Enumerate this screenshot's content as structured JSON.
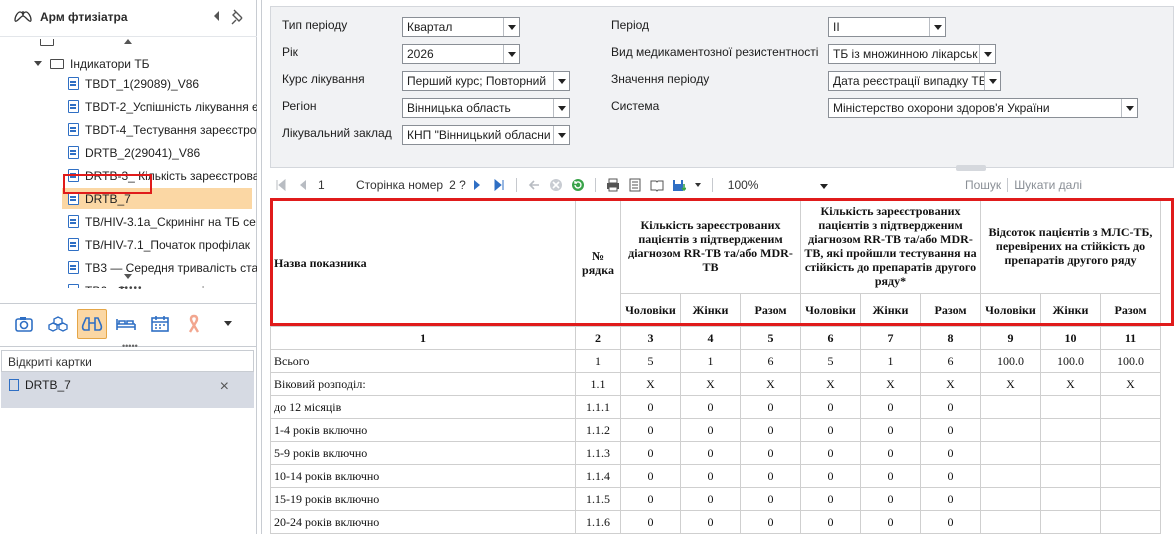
{
  "app": {
    "title": "Арм фтизіатра"
  },
  "tree": {
    "partial_top": "",
    "folder_label": "Індикатори ТБ",
    "items": [
      "TBDT_1(29089)_V86",
      "TBDT-2_Успішність лікування є",
      "TBDT-4_Тестування зареєстро",
      "DRTB_2(29041)_V86",
      "DRTB-3_ Кількість зареєстрова",
      "DRTB_7",
      "TB/HIV-3.1а_Скринінг на ТБ се",
      "TB/HIV-7.1_Початок профілак",
      "ТВ3 — Середня тривалість ста",
      "ТВ6 «Охоплення соціальним с"
    ],
    "selected_index": 5
  },
  "left_toolbar": {
    "icons": [
      "camera-icon",
      "cubes-icon",
      "binoculars-icon",
      "bed-icon",
      "calendar-icon",
      "ribbon-icon",
      "dropdown-icon"
    ],
    "active_index": 2
  },
  "open_cards": {
    "header": "Відкриті картки",
    "cards": [
      "DRTB_7"
    ]
  },
  "filters": {
    "period_type": {
      "label": "Тип періоду",
      "value": "Квартал"
    },
    "year": {
      "label": "Рік",
      "value": "2026"
    },
    "course": {
      "label": "Курс лікування",
      "value": "Перший курс; Повторний"
    },
    "region": {
      "label": "Регіон",
      "value": "Вінницька область"
    },
    "facility": {
      "label": "Лікувальний заклад",
      "value": "КНП \"Вінницький обласни"
    },
    "period": {
      "label": "Період",
      "value": "II"
    },
    "resistance": {
      "label": "Вид медикаментозної резистентності",
      "value": "ТБ із множинною лікарськ"
    },
    "period_value": {
      "label": "Значення періоду",
      "value": "Дата реєстрації випадку ТБ"
    },
    "system": {
      "label": "Система",
      "value": "Міністерство охорони здоров'я України"
    }
  },
  "pager": {
    "page": "1",
    "page_label": "Сторінка номер",
    "page_of": "2 ?",
    "zoom": "100%",
    "search": "Пошук",
    "search_next": "Шукати далі"
  },
  "report": {
    "headers": {
      "name": "Назва показника",
      "row_no": "№ рядка",
      "group1": "Кількість зареєстрованих пацієнтів з підтвердженим діагнозом RR-ТВ та/або MDR-ТВ",
      "group2": "Кількість зареєстрованих пацієнтів з підтвердженим діагнозом RR-ТВ та/або MDR-ТВ, які пройшли тестування на стійкість до препаратів другого ряду*",
      "group3": "Відсоток пацієнтів з МЛС-ТБ, перевірених на стійкість до препаратів другого ряду",
      "men": "Чоловіки",
      "women": "Жінки",
      "total": "Разом"
    },
    "col_numbers": [
      "1",
      "2",
      "3",
      "4",
      "5",
      "6",
      "7",
      "8",
      "9",
      "10",
      "11"
    ],
    "rows": [
      [
        "Всього",
        "1",
        "5",
        "1",
        "6",
        "5",
        "1",
        "6",
        "100.0",
        "100.0",
        "100.0"
      ],
      [
        "Віковий розподіл:",
        "1.1",
        "X",
        "X",
        "X",
        "X",
        "X",
        "X",
        "X",
        "X",
        "X"
      ],
      [
        "до 12 місяців",
        "1.1.1",
        "0",
        "0",
        "0",
        "0",
        "0",
        "0",
        "",
        "",
        ""
      ],
      [
        "1-4 років включно",
        "1.1.2",
        "0",
        "0",
        "0",
        "0",
        "0",
        "0",
        "",
        "",
        ""
      ],
      [
        "5-9 років включно",
        "1.1.3",
        "0",
        "0",
        "0",
        "0",
        "0",
        "0",
        "",
        "",
        ""
      ],
      [
        "10-14 років включно",
        "1.1.4",
        "0",
        "0",
        "0",
        "0",
        "0",
        "0",
        "",
        "",
        ""
      ],
      [
        "15-19 років включно",
        "1.1.5",
        "0",
        "0",
        "0",
        "0",
        "0",
        "0",
        "",
        "",
        ""
      ],
      [
        "20-24 років включно",
        "1.1.6",
        "0",
        "0",
        "0",
        "0",
        "0",
        "0",
        "",
        "",
        ""
      ]
    ]
  },
  "colors": {
    "selection": "#fbd7a4",
    "highlight_box": "#e01b1b",
    "doc_icon": "#2f6fc4"
  }
}
